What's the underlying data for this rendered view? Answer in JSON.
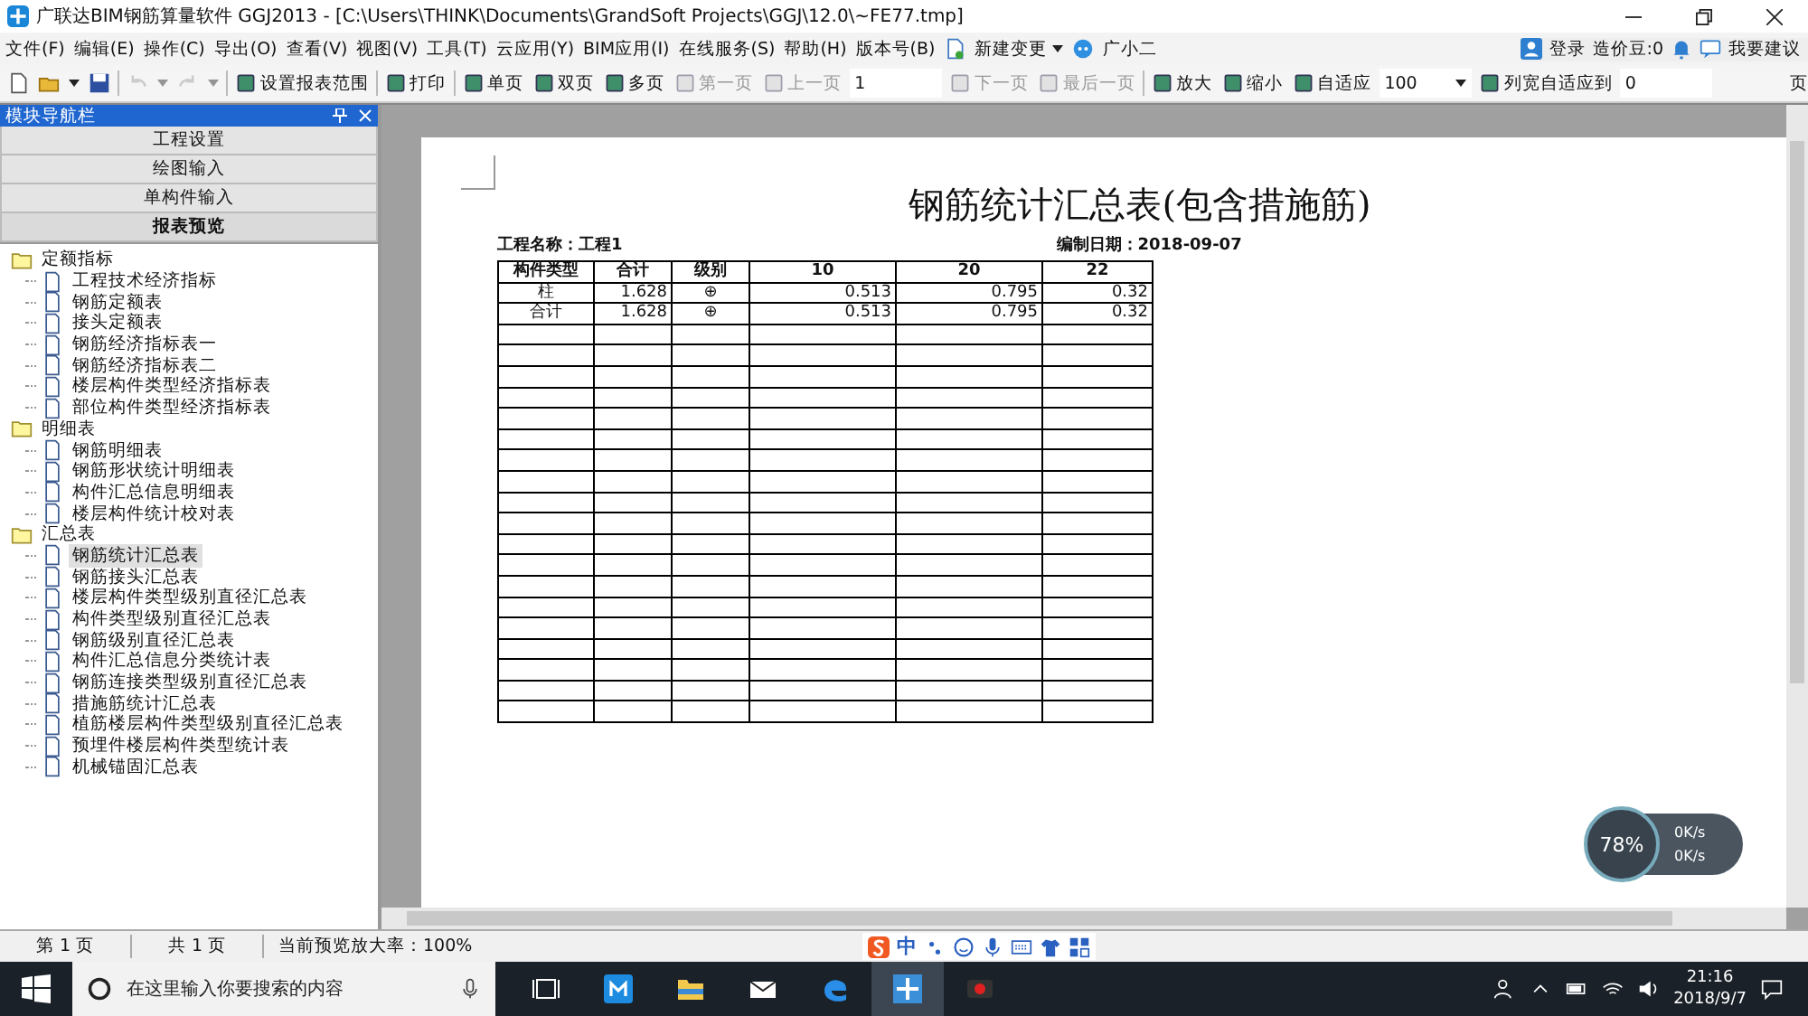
{
  "window": {
    "title": "广联达BIM钢筋算量软件 GGJ2013 - [C:\\Users\\THINK\\Documents\\GrandSoft Projects\\GGJ\\12.0\\~FE77.tmp]"
  },
  "menu": [
    "文件(F)",
    "编辑(E)",
    "操作(C)",
    "导出(O)",
    "查看(V)",
    "视图(V)",
    "工具(T)",
    "云应用(Y)",
    "BIM应用(I)",
    "在线服务(S)",
    "帮助(H)",
    "版本号(B)"
  ],
  "menu_extras": [
    {
      "label": "新建变更",
      "dropdown": true
    },
    {
      "label": "广小二",
      "dropdown": false
    }
  ],
  "account": {
    "login": "登录",
    "beans": "造价豆:0",
    "suggest": "我要建议"
  },
  "toolbar": [
    {
      "kind": "icon",
      "disabled": false,
      "dropdown": false
    },
    {
      "kind": "icon",
      "disabled": false,
      "dropdown": true
    },
    {
      "kind": "icon",
      "disabled": false,
      "dropdown": false
    },
    {
      "kind": "sep"
    },
    {
      "kind": "icon",
      "disabled": true,
      "dropdown": true
    },
    {
      "kind": "icon",
      "disabled": true,
      "dropdown": true
    },
    {
      "kind": "sep"
    },
    {
      "kind": "tool",
      "label": "设置报表范围",
      "disabled": false
    },
    {
      "kind": "sep"
    },
    {
      "kind": "tool",
      "label": "打印",
      "disabled": false
    },
    {
      "kind": "sep"
    },
    {
      "kind": "tool",
      "label": "单页",
      "disabled": false
    },
    {
      "kind": "tool",
      "label": "双页",
      "disabled": false
    },
    {
      "kind": "tool",
      "label": "多页",
      "disabled": false
    },
    {
      "kind": "tool",
      "label": "第一页",
      "disabled": true
    },
    {
      "kind": "tool",
      "label": "上一页",
      "disabled": true
    },
    {
      "kind": "field",
      "value": "1",
      "dropdown": false
    },
    {
      "kind": "tool",
      "label": "下一页",
      "disabled": true
    },
    {
      "kind": "tool",
      "label": "最后一页",
      "disabled": true
    },
    {
      "kind": "sep"
    },
    {
      "kind": "tool",
      "label": "放大",
      "disabled": false
    },
    {
      "kind": "tool",
      "label": "缩小",
      "disabled": false
    },
    {
      "kind": "tool",
      "label": "自适应",
      "disabled": false
    },
    {
      "kind": "field",
      "value": "100",
      "dropdown": true
    },
    {
      "kind": "tool",
      "label": "列宽自适应到",
      "disabled": false
    },
    {
      "kind": "field",
      "value": "0",
      "dropdown": false
    },
    {
      "kind": "text",
      "label": "页"
    }
  ],
  "nav": {
    "title": "模块导航栏",
    "sections": [
      {
        "label": "工程设置",
        "selected": false
      },
      {
        "label": "绘图输入",
        "selected": false
      },
      {
        "label": "单构件输入",
        "selected": false
      },
      {
        "label": "报表预览",
        "selected": true
      }
    ],
    "tree": [
      {
        "label": "定额指标",
        "children": [
          {
            "label": "工程技术经济指标",
            "selected": false
          },
          {
            "label": "钢筋定额表",
            "selected": false
          },
          {
            "label": "接头定额表",
            "selected": false
          },
          {
            "label": "钢筋经济指标表一",
            "selected": false
          },
          {
            "label": "钢筋经济指标表二",
            "selected": false
          },
          {
            "label": "楼层构件类型经济指标表",
            "selected": false
          },
          {
            "label": "部位构件类型经济指标表",
            "selected": false
          }
        ]
      },
      {
        "label": "明细表",
        "children": [
          {
            "label": "钢筋明细表",
            "selected": false
          },
          {
            "label": "钢筋形状统计明细表",
            "selected": false
          },
          {
            "label": "构件汇总信息明细表",
            "selected": false
          },
          {
            "label": "楼层构件统计校对表",
            "selected": false
          }
        ]
      },
      {
        "label": "汇总表",
        "children": [
          {
            "label": "钢筋统计汇总表",
            "selected": true
          },
          {
            "label": "钢筋接头汇总表",
            "selected": false
          },
          {
            "label": "楼层构件类型级别直径汇总表",
            "selected": false
          },
          {
            "label": "构件类型级别直径汇总表",
            "selected": false
          },
          {
            "label": "钢筋级别直径汇总表",
            "selected": false
          },
          {
            "label": "构件汇总信息分类统计表",
            "selected": false
          },
          {
            "label": "钢筋连接类型级别直径汇总表",
            "selected": false
          },
          {
            "label": "措施筋统计汇总表",
            "selected": false
          },
          {
            "label": "植筋楼层构件类型级别直径汇总表",
            "selected": false
          },
          {
            "label": "预埋件楼层构件类型统计表",
            "selected": false
          },
          {
            "label": "机械锚固汇总表",
            "selected": false
          }
        ]
      }
    ]
  },
  "report": {
    "title": "钢筋统计汇总表(包含措施筋)",
    "project": "工程名称：工程1",
    "date": "编制日期：2018-09-07",
    "columns": [
      "构件类型",
      "合计",
      "级别",
      "10",
      "20",
      "22"
    ],
    "rows": [
      [
        "柱",
        "1.628",
        "⊕",
        "0.513",
        "0.795",
        "0.32"
      ],
      [
        "合计",
        "1.628",
        "⊕",
        "0.513",
        "0.795",
        "0.32"
      ]
    ]
  },
  "status_bar": [
    "第 1 页",
    "共 1 页",
    "当前预览放大率：100%"
  ],
  "ime": {
    "label": "中"
  },
  "speed_widget": {
    "percent": "78%",
    "up": "0K/s",
    "down": "0K/s"
  },
  "taskbar": {
    "search_placeholder": "在这里输入你要搜索的内容",
    "time": "21:16",
    "date": "2018/9/7"
  }
}
